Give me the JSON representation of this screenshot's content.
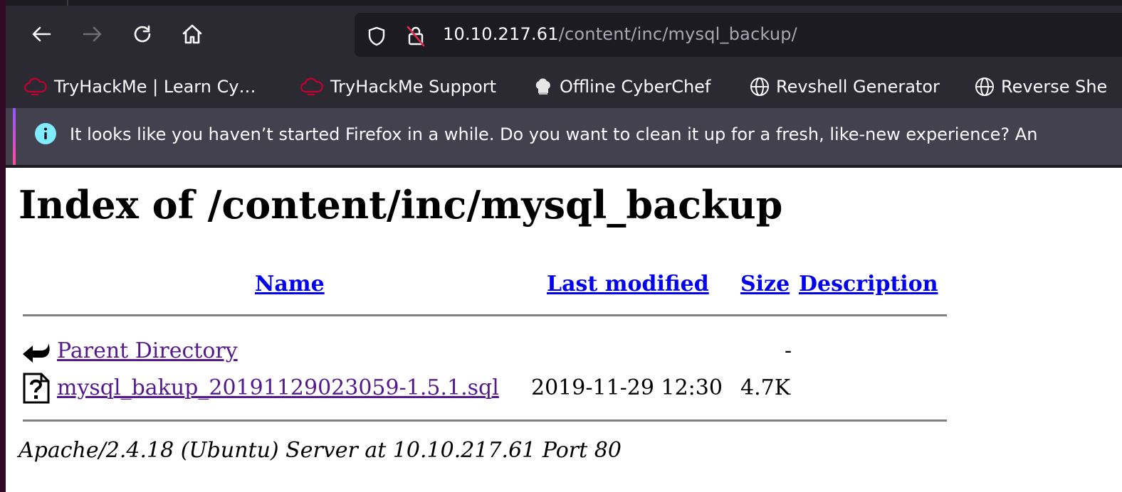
{
  "browser": {
    "address_bar": {
      "host": "10.10.217.61",
      "path": "/content/inc/mysql_backup/"
    },
    "bookmarks": [
      {
        "label": "TryHackMe | Learn Cy…",
        "icon": "tryhackme-cloud-icon"
      },
      {
        "label": "TryHackMe Support",
        "icon": "tryhackme-cloud-icon"
      },
      {
        "label": "Offline CyberChef",
        "icon": "chef-hat-icon"
      },
      {
        "label": "Revshell Generator",
        "icon": "globe-icon"
      },
      {
        "label": "Reverse She",
        "icon": "globe-icon"
      }
    ],
    "notification": {
      "text": "It looks like you haven’t started Firefox in a while. Do you want to clean it up for a fresh, like-new experience? An"
    }
  },
  "listing": {
    "title": "Index of /content/inc/mysql_backup",
    "columns": {
      "name": "Name",
      "last_modified": "Last modified",
      "size": "Size",
      "description": "Description"
    },
    "rows": [
      {
        "name": "Parent Directory",
        "last_modified": "",
        "size": "-",
        "icon": "back-arrow-icon"
      },
      {
        "name": "mysql_bakup_20191129023059-1.5.1.sql",
        "last_modified": "2019-11-29 12:30",
        "size": "4.7K",
        "icon": "unknown-file-icon"
      }
    ],
    "address": "Apache/2.4.18 (Ubuntu) Server at 10.10.217.61 Port 80"
  },
  "colors": {
    "toolbar_bg": "#2b2a33",
    "urlbar_bg": "#1c1b22",
    "link": "#0000ee",
    "visited_link": "#551a8b"
  }
}
